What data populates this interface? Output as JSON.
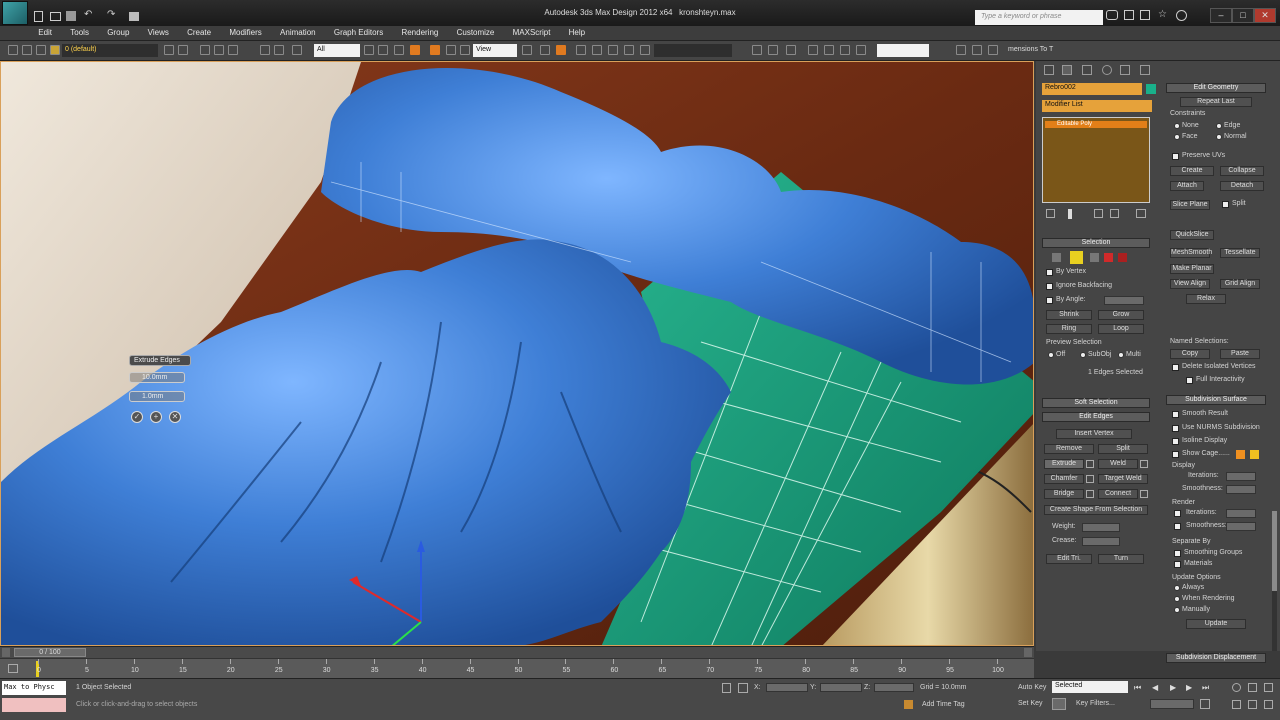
{
  "app": {
    "title": "Autodesk 3ds Max Design 2012 x64",
    "file": "kronshteyn.max",
    "search_placeholder": "Type a keyword or phrase",
    "min_label": "–",
    "max_label": "□",
    "close_label": "✕"
  },
  "menu": {
    "items": [
      "Edit",
      "Tools",
      "Group",
      "Views",
      "Create",
      "Modifiers",
      "Animation",
      "Graph Editors",
      "Rendering",
      "Customize",
      "MAXScript",
      "Help"
    ]
  },
  "toolbar": {
    "layer_name": "0 (default)",
    "filter": "All",
    "coord": "View",
    "named_sel": "",
    "extra_label": "mensions To T"
  },
  "viewport": {
    "caddy_title": "Extrude Edges",
    "caddy_height": "10.0mm",
    "caddy_width": "1.0mm",
    "caddy_ok": "✓",
    "caddy_add": "+",
    "caddy_cancel": "✕"
  },
  "command_panel": {
    "object_name": "Rebro002",
    "modifier_list": "Modifier List",
    "stack_item": "Editable Poly",
    "object_color": "#19b08a",
    "selection_title": "Selection",
    "by_vertex": "By Vertex",
    "ignore_backfacing": "Ignore Backfacing",
    "by_angle": "By Angle:",
    "shrink": "Shrink",
    "grow": "Grow",
    "ring": "Ring",
    "loop": "Loop",
    "preview_selection": "Preview Selection",
    "off": "Off",
    "subobj": "SubObj",
    "multi": "Multi",
    "edges_selected": "1 Edges Selected",
    "soft_selection": "Soft Selection",
    "edit_edges": "Edit Edges",
    "insert_vertex": "Insert Vertex",
    "remove": "Remove",
    "split": "Split",
    "extrude": "Extrude",
    "weld": "Weld",
    "chamfer": "Chamfer",
    "target_weld": "Target Weld",
    "bridge": "Bridge",
    "connect": "Connect",
    "create_shape": "Create Shape From Selection",
    "weight": "Weight:",
    "crease": "Crease:",
    "edit_tri": "Edit Tri.",
    "turn": "Turn",
    "edit_geometry": "Edit Geometry",
    "repeat_last": "Repeat Last",
    "constraints": "Constraints",
    "none": "None",
    "edge": "Edge",
    "face": "Face",
    "normal": "Normal",
    "preserve_uvs": "Preserve UVs",
    "create": "Create",
    "collapse": "Collapse",
    "attach": "Attach",
    "detach": "Detach",
    "slice_plane": "Slice Plane",
    "split2": "Split",
    "quickslice": "QuickSlice",
    "meshsmooth": "MeshSmooth",
    "tessellate": "Tessellate",
    "make_planar": "Make Planar",
    "view_align": "View Align",
    "grid_align": "Grid Align",
    "relax": "Relax",
    "named_selections": "Named Selections:",
    "copy": "Copy",
    "paste": "Paste",
    "delete_isolated": "Delete Isolated Vertices",
    "full_interactivity": "Full Interactivity",
    "subdivision_surface": "Subdivision Surface",
    "smooth_result": "Smooth Result",
    "use_nurms": "Use NURMS Subdivision",
    "isoline_display": "Isoline Display",
    "show_cage": "Show Cage......",
    "display": "Display",
    "iterations": "Iterations:",
    "smoothness": "Smoothness:",
    "render": "Render",
    "separate_by": "Separate By",
    "smoothing_groups": "Smoothing Groups",
    "materials": "Materials",
    "update_options": "Update Options",
    "always": "Always",
    "when_rendering": "When Rendering",
    "manually": "Manually",
    "update": "Update",
    "subdivision_displacement": "Subdivision Displacement"
  },
  "timeline": {
    "frame": "0 / 100",
    "ticks": [
      "0",
      "5",
      "10",
      "15",
      "20",
      "25",
      "30",
      "35",
      "40",
      "45",
      "50",
      "55",
      "60",
      "65",
      "70",
      "75",
      "80",
      "85",
      "90",
      "95",
      "100"
    ]
  },
  "status": {
    "maxscript": "Max to Physc",
    "selected": "1 Object Selected",
    "prompt": "Click or click-and-drag to select objects",
    "x_label": "X:",
    "y_label": "Y:",
    "z_label": "Z:",
    "grid": "Grid = 10.0mm",
    "add_time_tag": "Add Time Tag",
    "auto_key": "Auto Key",
    "set_key": "Set Key",
    "key_mode": "Selected",
    "key_filters": "Key Filters..."
  }
}
